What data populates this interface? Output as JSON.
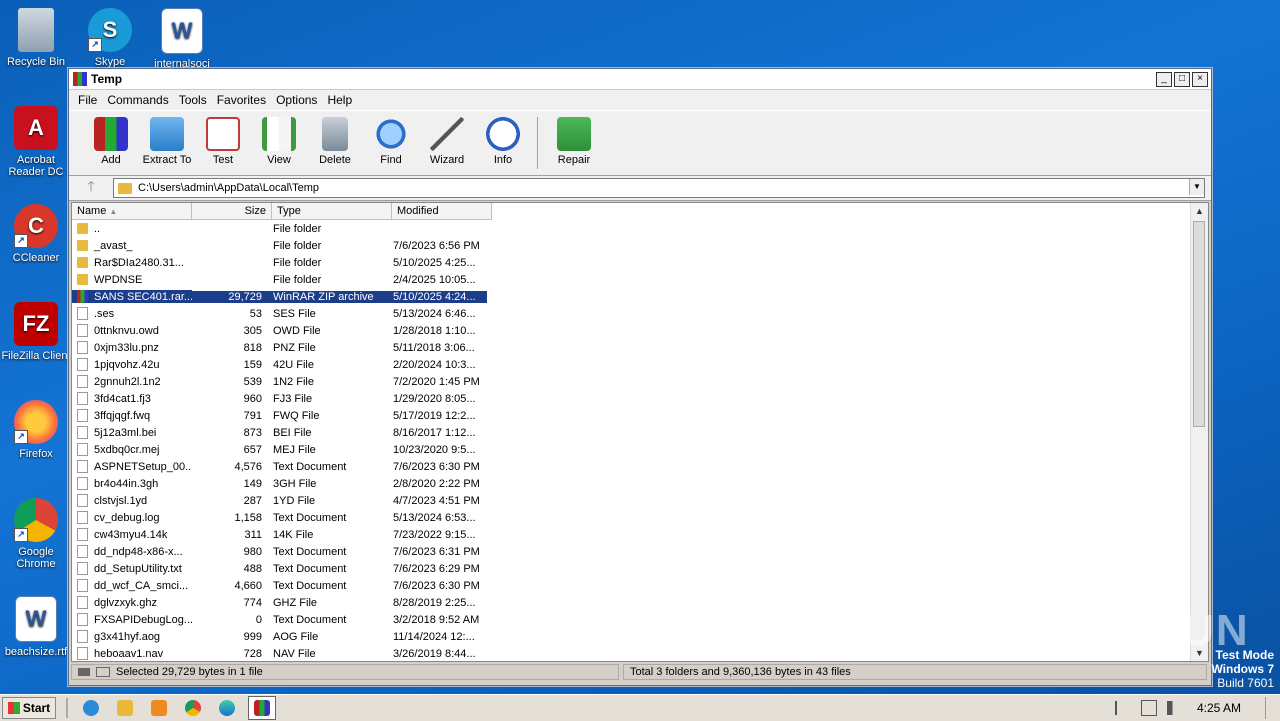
{
  "desktop_icons": [
    {
      "label": "Recycle Bin",
      "icon": "recycle-bin-icon"
    },
    {
      "label": "Skype",
      "icon": "skype-icon"
    },
    {
      "label": "internalsoci",
      "icon": "word-doc-icon"
    },
    {
      "label": "Acrobat Reader DC",
      "icon": "acrobat-icon"
    },
    {
      "label": "CCleaner",
      "icon": "ccleaner-icon"
    },
    {
      "label": "FileZilla Client",
      "icon": "filezilla-icon"
    },
    {
      "label": "Firefox",
      "icon": "firefox-icon"
    },
    {
      "label": "Google Chrome",
      "icon": "chrome-icon"
    },
    {
      "label": "beachsize.rtf",
      "icon": "word-doc-icon"
    }
  ],
  "window": {
    "title": "Temp",
    "menu": [
      "File",
      "Commands",
      "Tools",
      "Favorites",
      "Options",
      "Help"
    ],
    "toolbar": [
      {
        "label": "Add",
        "icon": "add-archive-icon",
        "color": "#b03030"
      },
      {
        "label": "Extract To",
        "icon": "extract-folder-icon",
        "color": "#3a8fd8"
      },
      {
        "label": "Test",
        "icon": "test-checklist-icon",
        "color": "#c03a3a"
      },
      {
        "label": "View",
        "icon": "view-book-icon",
        "color": "#3f9a3f"
      },
      {
        "label": "Delete",
        "icon": "trash-icon",
        "color": "#8a9aa8"
      },
      {
        "label": "Find",
        "icon": "magnifier-icon",
        "color": "#2a6fc8"
      },
      {
        "label": "Wizard",
        "icon": "wand-icon",
        "color": "#c8b040"
      },
      {
        "label": "Info",
        "icon": "info-icon",
        "color": "#2a5fc0"
      },
      {
        "label": "Repair",
        "icon": "repair-icon",
        "color": "#2f8f3a"
      }
    ],
    "address": "C:\\Users\\admin\\AppData\\Local\\Temp",
    "columns": {
      "name": "Name",
      "size": "Size",
      "type": "Type",
      "modified": "Modified"
    },
    "files": [
      {
        "name": "..",
        "size": "",
        "type": "File folder",
        "modified": "",
        "kind": "folder"
      },
      {
        "name": "_avast_",
        "size": "",
        "type": "File folder",
        "modified": "7/6/2023 6:56 PM",
        "kind": "folder"
      },
      {
        "name": "Rar$DIa2480.31...",
        "size": "",
        "type": "File folder",
        "modified": "5/10/2025 4:25...",
        "kind": "folder"
      },
      {
        "name": "WPDNSE",
        "size": "",
        "type": "File folder",
        "modified": "2/4/2025 10:05...",
        "kind": "folder"
      },
      {
        "name": "SANS SEC401.rar...",
        "size": "29,729",
        "type": "WinRAR ZIP archive",
        "modified": "5/10/2025 4:24...",
        "kind": "rar",
        "selected": true
      },
      {
        "name": ".ses",
        "size": "53",
        "type": "SES File",
        "modified": "5/13/2024 6:46...",
        "kind": "file"
      },
      {
        "name": "0ttnknvu.owd",
        "size": "305",
        "type": "OWD File",
        "modified": "1/28/2018 1:10...",
        "kind": "file"
      },
      {
        "name": "0xjm33lu.pnz",
        "size": "818",
        "type": "PNZ File",
        "modified": "5/11/2018 3:06...",
        "kind": "file"
      },
      {
        "name": "1pjqvohz.42u",
        "size": "159",
        "type": "42U File",
        "modified": "2/20/2024 10:3...",
        "kind": "file"
      },
      {
        "name": "2gnnuh2l.1n2",
        "size": "539",
        "type": "1N2 File",
        "modified": "7/2/2020 1:45 PM",
        "kind": "file"
      },
      {
        "name": "3fd4cat1.fj3",
        "size": "960",
        "type": "FJ3 File",
        "modified": "1/29/2020 8:05...",
        "kind": "file"
      },
      {
        "name": "3ffqjqgf.fwq",
        "size": "791",
        "type": "FWQ File",
        "modified": "5/17/2019 12:2...",
        "kind": "file"
      },
      {
        "name": "5j12a3ml.bei",
        "size": "873",
        "type": "BEI File",
        "modified": "8/16/2017 1:12...",
        "kind": "file"
      },
      {
        "name": "5xdbq0cr.mej",
        "size": "657",
        "type": "MEJ File",
        "modified": "10/23/2020 9:5...",
        "kind": "file"
      },
      {
        "name": "ASPNETSetup_00...",
        "size": "4,576",
        "type": "Text Document",
        "modified": "7/6/2023 6:30 PM",
        "kind": "file"
      },
      {
        "name": "br4o44in.3gh",
        "size": "149",
        "type": "3GH File",
        "modified": "2/8/2020 2:22 PM",
        "kind": "file"
      },
      {
        "name": "clstvjsl.1yd",
        "size": "287",
        "type": "1YD File",
        "modified": "4/7/2023 4:51 PM",
        "kind": "file"
      },
      {
        "name": "cv_debug.log",
        "size": "1,158",
        "type": "Text Document",
        "modified": "5/13/2024 6:53...",
        "kind": "file"
      },
      {
        "name": "cw43myu4.14k",
        "size": "311",
        "type": "14K File",
        "modified": "7/23/2022 9:15...",
        "kind": "file"
      },
      {
        "name": "dd_ndp48-x86-x...",
        "size": "980",
        "type": "Text Document",
        "modified": "7/6/2023 6:31 PM",
        "kind": "file"
      },
      {
        "name": "dd_SetupUtility.txt",
        "size": "488",
        "type": "Text Document",
        "modified": "7/6/2023 6:29 PM",
        "kind": "file"
      },
      {
        "name": "dd_wcf_CA_smci...",
        "size": "4,660",
        "type": "Text Document",
        "modified": "7/6/2023 6:30 PM",
        "kind": "file"
      },
      {
        "name": "dglvzxyk.ghz",
        "size": "774",
        "type": "GHZ File",
        "modified": "8/28/2019 2:25...",
        "kind": "file"
      },
      {
        "name": "FXSAPIDebugLog...",
        "size": "0",
        "type": "Text Document",
        "modified": "3/2/2018 9:52 AM",
        "kind": "file"
      },
      {
        "name": "g3x41hyf.aog",
        "size": "999",
        "type": "AOG File",
        "modified": "11/14/2024 12:...",
        "kind": "file"
      },
      {
        "name": "heboaav1.nav",
        "size": "728",
        "type": "NAV File",
        "modified": "3/26/2019 8:44...",
        "kind": "file"
      }
    ],
    "status_left": "Selected 29,729 bytes in 1 file",
    "status_right": "Total 3 folders and 9,360,136 bytes in 43 files"
  },
  "taskbar": {
    "start_label": "Start",
    "clock": "4:25 AM",
    "apps": [
      "ie-icon",
      "explorer-icon",
      "media-player-icon",
      "chrome-icon",
      "edge-icon",
      "winrar-icon"
    ]
  },
  "overlay": {
    "watermark": "ANY RUN",
    "testmode_line1": "Test Mode",
    "testmode_line2": "Windows 7",
    "testmode_line3": "Build 7601"
  }
}
